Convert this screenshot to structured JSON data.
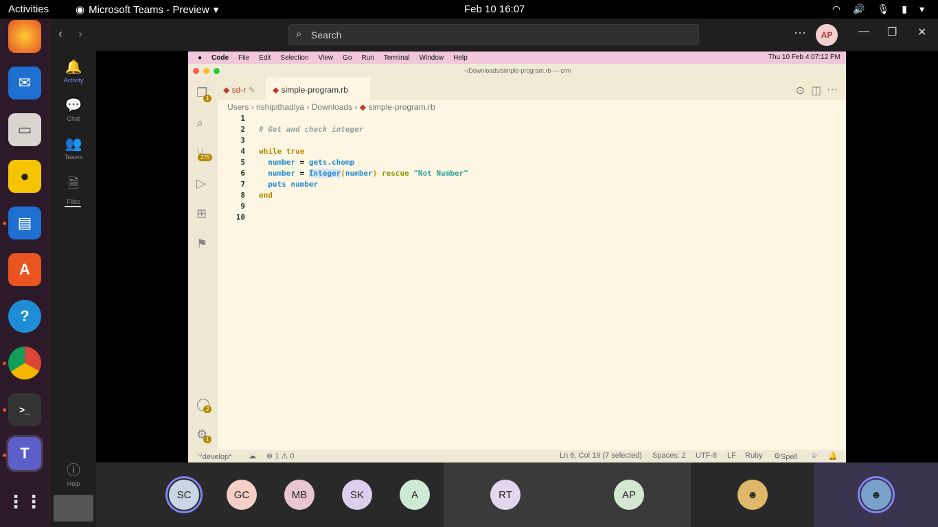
{
  "system": {
    "activities": "Activities",
    "app_title": "Microsoft Teams - Preview",
    "clock": "Feb 10  16:07"
  },
  "teams": {
    "search_placeholder": "Search",
    "avatar": "AP",
    "rail": [
      {
        "label": "Activity"
      },
      {
        "label": "Chat"
      },
      {
        "label": "Teams"
      },
      {
        "label": "Files"
      },
      {
        "label": "Help"
      }
    ]
  },
  "shared": {
    "mac_menu": [
      "Code",
      "File",
      "Edit",
      "Selection",
      "View",
      "Go",
      "Run",
      "Terminal",
      "Window",
      "Help"
    ],
    "mac_clock": "Thu 10 Feb  4:07:12 PM",
    "window_title": "~/Downloads/simple-program.rb — crm",
    "tabs": {
      "inactive": "sd-r",
      "active": "simple-program.rb"
    },
    "breadcrumb": [
      "Users",
      "rishipithadiya",
      "Downloads",
      "simple-program.rb"
    ],
    "badges": {
      "explorer": "1",
      "scm": "275",
      "accounts": "2",
      "manage": "1"
    },
    "line_numbers": [
      "1",
      "2",
      "3",
      "4",
      "5",
      "6",
      "7",
      "8",
      "9",
      "10"
    ],
    "status": {
      "branch": "develop*",
      "problems": "⊗ 1 ⚠ 0",
      "position": "Ln 6, Col 19 (7 selected)",
      "spaces": "Spaces: 2",
      "encoding": "UTF-8",
      "eol": "LF",
      "language": "Ruby",
      "spell": "Spell"
    }
  },
  "participants": [
    "SC",
    "GC",
    "MB",
    "SK",
    "A",
    "RT",
    "AP"
  ]
}
